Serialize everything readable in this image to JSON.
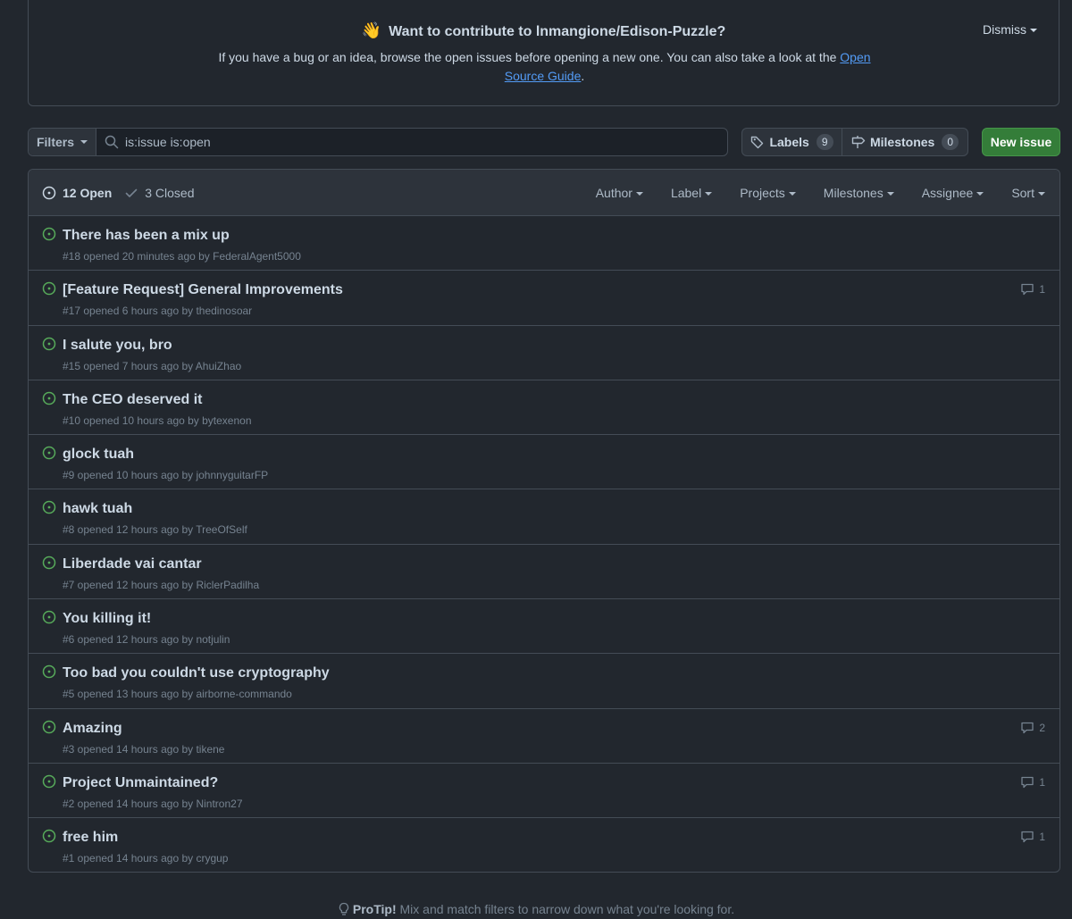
{
  "banner": {
    "emoji": "👋",
    "title": "Want to contribute to lnmangione/Edison-Puzzle?",
    "desc_before": "If you have a bug or an idea, browse the open issues before opening a new one. You can also take a look at the ",
    "link_text": "Open Source Guide",
    "desc_after": ".",
    "dismiss_label": "Dismiss"
  },
  "toolbar": {
    "filters_label": "Filters",
    "search_value": "is:issue is:open",
    "labels_label": "Labels",
    "labels_count": "9",
    "milestones_label": "Milestones",
    "milestones_count": "0",
    "new_issue_label": "New issue"
  },
  "header": {
    "open_label": "12 Open",
    "closed_label": "3 Closed",
    "filters": [
      "Author",
      "Label",
      "Projects",
      "Milestones",
      "Assignee",
      "Sort"
    ]
  },
  "issues": [
    {
      "title": "There has been a mix up",
      "meta": "#18 opened 20 minutes ago by FederalAgent5000",
      "comments": ""
    },
    {
      "title": "[Feature Request] General Improvements",
      "meta": "#17 opened 6 hours ago by thedinosoar",
      "comments": "1"
    },
    {
      "title": "I salute you, bro",
      "meta": "#15 opened 7 hours ago by AhuiZhao",
      "comments": ""
    },
    {
      "title": "The CEO deserved it",
      "meta": "#10 opened 10 hours ago by bytexenon",
      "comments": ""
    },
    {
      "title": "glock tuah",
      "meta": "#9 opened 10 hours ago by johnnyguitarFP",
      "comments": ""
    },
    {
      "title": "hawk tuah",
      "meta": "#8 opened 12 hours ago by TreeOfSelf",
      "comments": ""
    },
    {
      "title": "Liberdade vai cantar",
      "meta": "#7 opened 12 hours ago by RiclerPadilha",
      "comments": ""
    },
    {
      "title": "You killing it!",
      "meta": "#6 opened 12 hours ago by notjulin",
      "comments": ""
    },
    {
      "title": "Too bad you couldn't use cryptography",
      "meta": "#5 opened 13 hours ago by airborne-commando",
      "comments": ""
    },
    {
      "title": "Amazing",
      "meta": "#3 opened 14 hours ago by tikene",
      "comments": "2"
    },
    {
      "title": "Project Unmaintained?",
      "meta": "#2 opened 14 hours ago by Nintron27",
      "comments": "1"
    },
    {
      "title": "free him",
      "meta": "#1 opened 14 hours ago by crygup",
      "comments": "1"
    }
  ],
  "protip": {
    "label": "ProTip!",
    "text": " Mix and match filters to narrow down what you're looking for."
  },
  "colors": {
    "background": "#22272e",
    "open_icon": "#57ab5a",
    "primary_button": "#347d39",
    "link": "#539bf5"
  }
}
